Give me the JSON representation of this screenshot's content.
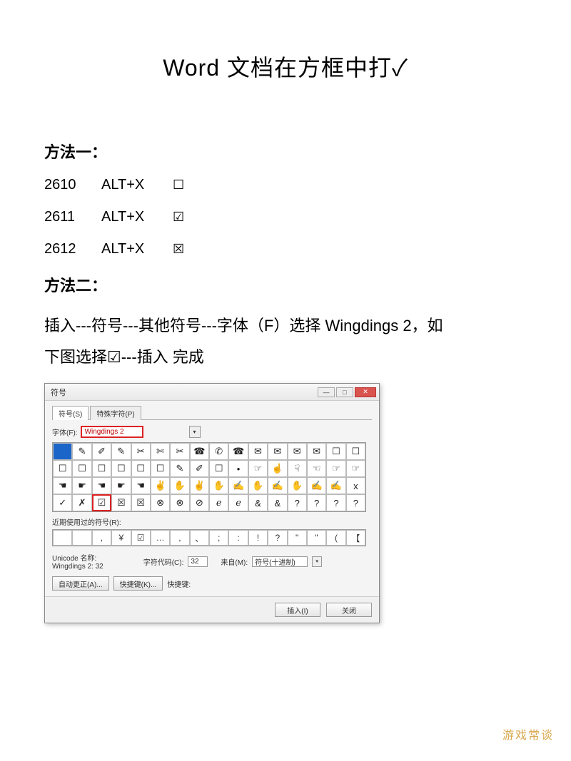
{
  "title": "Word 文档在方框中打✓",
  "method1_label": "方法一：",
  "codes": [
    {
      "code": "2610",
      "key": "ALT+X",
      "glyph": "☐"
    },
    {
      "code": "2611",
      "key": "ALT+X",
      "glyph": "☑"
    },
    {
      "code": "2612",
      "key": "ALT+X",
      "glyph": "☒"
    }
  ],
  "method2_label": "方法二：",
  "method2_text_line1": "插入---符号---其他符号---字体（F）选择 Wingdings 2，如",
  "method2_text_line2": "下图选择☑---插入 完成",
  "dialog": {
    "title": "符号",
    "tabs": {
      "symbols": "符号(S)",
      "special": "特殊字符(P)"
    },
    "font_label": "字体(F):",
    "font_value": "Wingdings 2",
    "grid_rows": [
      [
        "",
        "✎",
        "✐",
        "✎",
        "✂",
        "✄",
        "✂",
        "☎",
        "✆",
        "☎",
        "✉",
        "✉",
        "✉",
        "✉",
        "☐",
        "☐"
      ],
      [
        "☐",
        "☐",
        "☐",
        "☐",
        "☐",
        "☐",
        "✎",
        "✐",
        "☐",
        "•",
        "☞",
        "☝",
        "☟",
        "☜",
        "☞",
        "☞"
      ],
      [
        "☚",
        "☛",
        "☚",
        "☛",
        "☚",
        "✌",
        "✋",
        "✌",
        "✋",
        "✍",
        "✋",
        "✍",
        "✋",
        "✍",
        "✍",
        "x"
      ],
      [
        "✓",
        "✗",
        "☑",
        "☒",
        "☒",
        "⊗",
        "⊗",
        "⊘",
        "ℯ",
        "ℯ",
        "&",
        "&",
        "?",
        "?",
        "?",
        "?"
      ]
    ],
    "recent_label": "近期使用过的符号(R):",
    "recent_row": [
      "",
      "",
      ",",
      "¥",
      "☑",
      "…",
      ",",
      "、",
      ";",
      ":",
      "!",
      "?",
      "\"",
      "\"",
      "(",
      "【"
    ],
    "unicode_name_label": "Unicode 名称:",
    "unicode_name_value": "Wingdings 2: 32",
    "charcode_label": "字符代码(C):",
    "charcode_value": "32",
    "from_label": "来自(M):",
    "from_value": "符号(十进制)",
    "autocorrect_btn": "自动更正(A)...",
    "shortcut_btn": "快捷键(K)...",
    "shortcut_label": "快捷键:",
    "insert_btn": "插入(I)",
    "close_btn": "关闭"
  },
  "watermark": "游戏常谈"
}
